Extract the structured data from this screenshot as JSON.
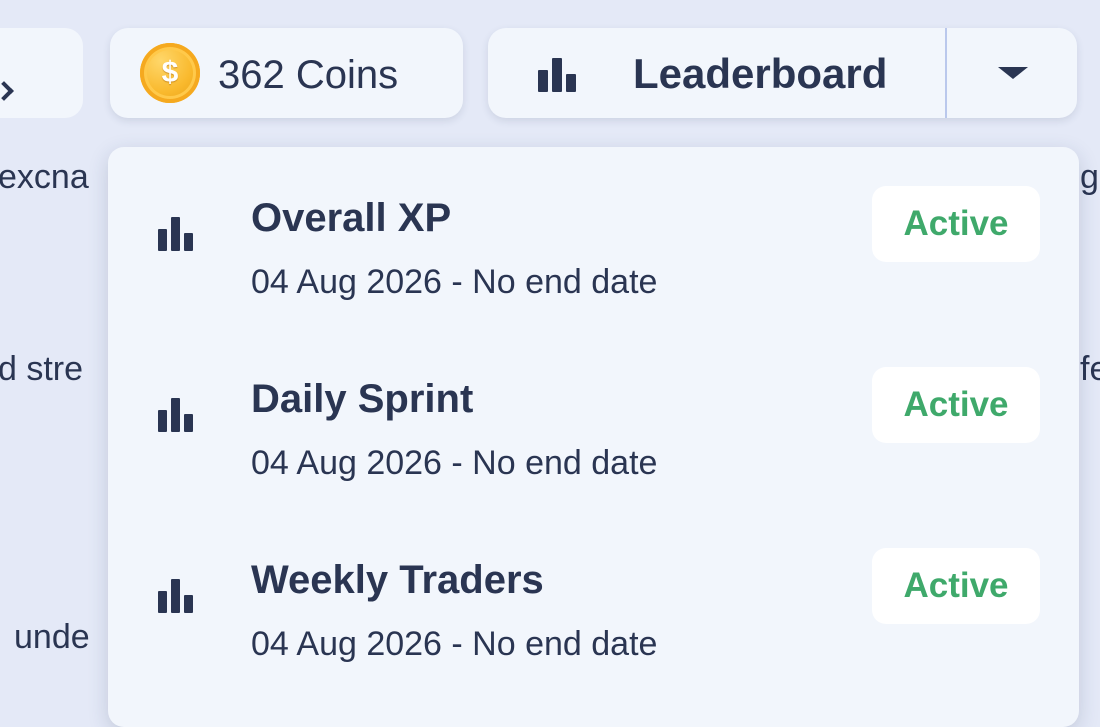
{
  "background": {
    "snippets": [
      "excna",
      "d stre",
      "unde",
      "gr",
      "fe"
    ]
  },
  "nav": {
    "forward_icon": "chevron-right-icon"
  },
  "coins": {
    "icon": "coin-icon",
    "symbol": "$",
    "label": "362 Coins"
  },
  "leaderboard_button": {
    "icon": "bar-chart-icon",
    "label": "Leaderboard",
    "dropdown_icon": "caret-down-icon"
  },
  "dropdown": {
    "items": [
      {
        "title": "Overall XP",
        "date_range": "04 Aug 2026 - No end date",
        "status": "Active"
      },
      {
        "title": "Daily Sprint",
        "date_range": "04 Aug 2026 - No end date",
        "status": "Active"
      },
      {
        "title": "Weekly Traders",
        "date_range": "04 Aug 2026 - No end date",
        "status": "Active"
      }
    ]
  },
  "colors": {
    "background": "#e4e9f7",
    "surface": "#f2f6fc",
    "text": "#2a3552",
    "status_active": "#3fa96b",
    "separator": "#bac8ec"
  }
}
